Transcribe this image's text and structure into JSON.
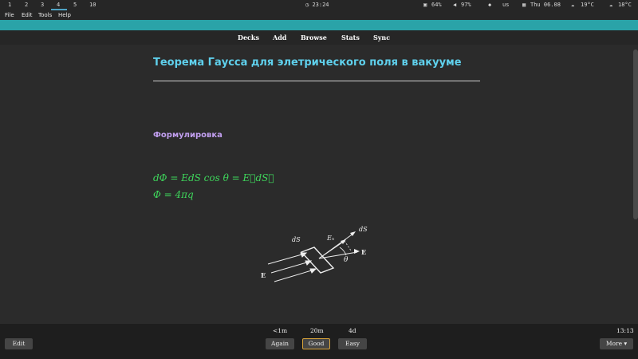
{
  "system_bar": {
    "workspaces": [
      "1",
      "2",
      "3",
      "4",
      "5",
      "10"
    ],
    "active_workspace": "4",
    "clock": "23:24",
    "battery": "64%",
    "volume": "97%",
    "keyboard": "us",
    "date": "Thu 06.08",
    "weather_1": "19°C",
    "weather_2": "18°C"
  },
  "menu": [
    "File",
    "Edit",
    "Tools",
    "Help"
  ],
  "nav": [
    "Decks",
    "Add",
    "Browse",
    "Stats",
    "Sync"
  ],
  "card": {
    "title": "Теорема Гаусса для элетрического поля в вакууме",
    "section": "Формулировка",
    "formula_1": "dΦ = EdS cos θ = E⃗dS⃗",
    "formula_2": "Φ = 4πq",
    "diagram_labels": [
      "dS",
      "Eₙ",
      "dS",
      "E",
      "θ",
      "E"
    ]
  },
  "answer_bar": {
    "edit": "Edit",
    "intervals": [
      "<1m",
      "20m",
      "4d"
    ],
    "buttons": [
      "Again",
      "Good",
      "Easy"
    ],
    "time": "13:13",
    "more": "More ▾"
  },
  "colors": {
    "accent": "#2aa3a8",
    "title": "#5fd0ec",
    "section": "#c29ff0",
    "formula": "#3ed65b"
  }
}
